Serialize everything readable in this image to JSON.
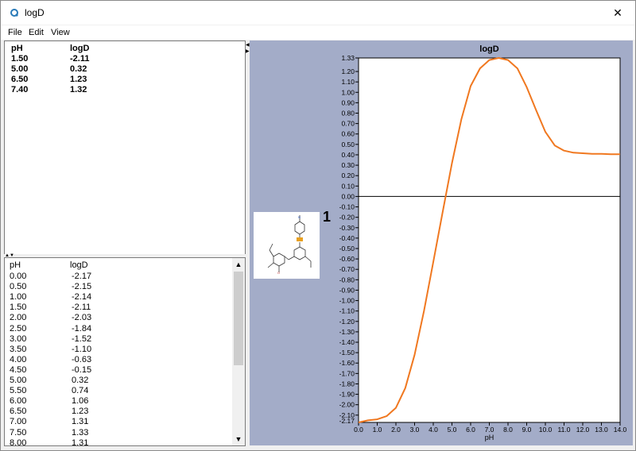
{
  "window": {
    "title": "logD",
    "close_icon": "✕"
  },
  "menu": [
    "File",
    "Edit",
    "View"
  ],
  "summary_table": {
    "headers": [
      "pH",
      "logD"
    ],
    "rows": [
      [
        "1.50",
        "-2.11"
      ],
      [
        "5.00",
        "0.32"
      ],
      [
        "6.50",
        "1.23"
      ],
      [
        "7.40",
        "1.32"
      ]
    ]
  },
  "full_table": {
    "headers": [
      "pH",
      "logD"
    ],
    "rows": [
      [
        "0.00",
        "-2.17"
      ],
      [
        "0.50",
        "-2.15"
      ],
      [
        "1.00",
        "-2.14"
      ],
      [
        "1.50",
        "-2.11"
      ],
      [
        "2.00",
        "-2.03"
      ],
      [
        "2.50",
        "-1.84"
      ],
      [
        "3.00",
        "-1.52"
      ],
      [
        "3.50",
        "-1.10"
      ],
      [
        "4.00",
        "-0.63"
      ],
      [
        "4.50",
        "-0.15"
      ],
      [
        "5.00",
        "0.32"
      ],
      [
        "5.50",
        "0.74"
      ],
      [
        "6.00",
        "1.06"
      ],
      [
        "6.50",
        "1.23"
      ],
      [
        "7.00",
        "1.31"
      ],
      [
        "7.50",
        "1.33"
      ],
      [
        "8.00",
        "1.31"
      ]
    ]
  },
  "molecule": {
    "label": "1"
  },
  "chart_data": {
    "type": "line",
    "title": "logD",
    "xlabel": "pH",
    "ylabel": "",
    "xlim": [
      0,
      14
    ],
    "ylim": [
      -2.17,
      1.33
    ],
    "x_ticks": [
      0,
      1,
      2,
      3,
      4,
      5,
      6,
      7,
      8,
      9,
      10,
      11,
      12,
      13,
      14
    ],
    "y_top_label": "1.33",
    "y_bottom_label": "-2.17",
    "grid": false,
    "colors": {
      "line": "#f07820",
      "zero_line": "#000000",
      "plot_bg": "#ffffff",
      "outer_bg": "#a3acc8"
    },
    "series": [
      {
        "x": [
          0,
          0.5,
          1,
          1.5,
          2,
          2.5,
          3,
          3.5,
          4,
          4.5,
          5,
          5.5,
          6,
          6.5,
          7,
          7.5,
          8,
          8.5,
          9,
          9.5,
          10,
          10.5,
          11,
          11.5,
          12,
          12.5,
          13,
          13.5,
          14
        ],
        "y": [
          -2.17,
          -2.15,
          -2.14,
          -2.11,
          -2.03,
          -1.84,
          -1.52,
          -1.1,
          -0.63,
          -0.15,
          0.32,
          0.74,
          1.06,
          1.23,
          1.31,
          1.33,
          1.31,
          1.23,
          1.05,
          0.83,
          0.62,
          0.49,
          0.44,
          0.42,
          0.415,
          0.41,
          0.41,
          0.405,
          0.405
        ]
      }
    ]
  }
}
